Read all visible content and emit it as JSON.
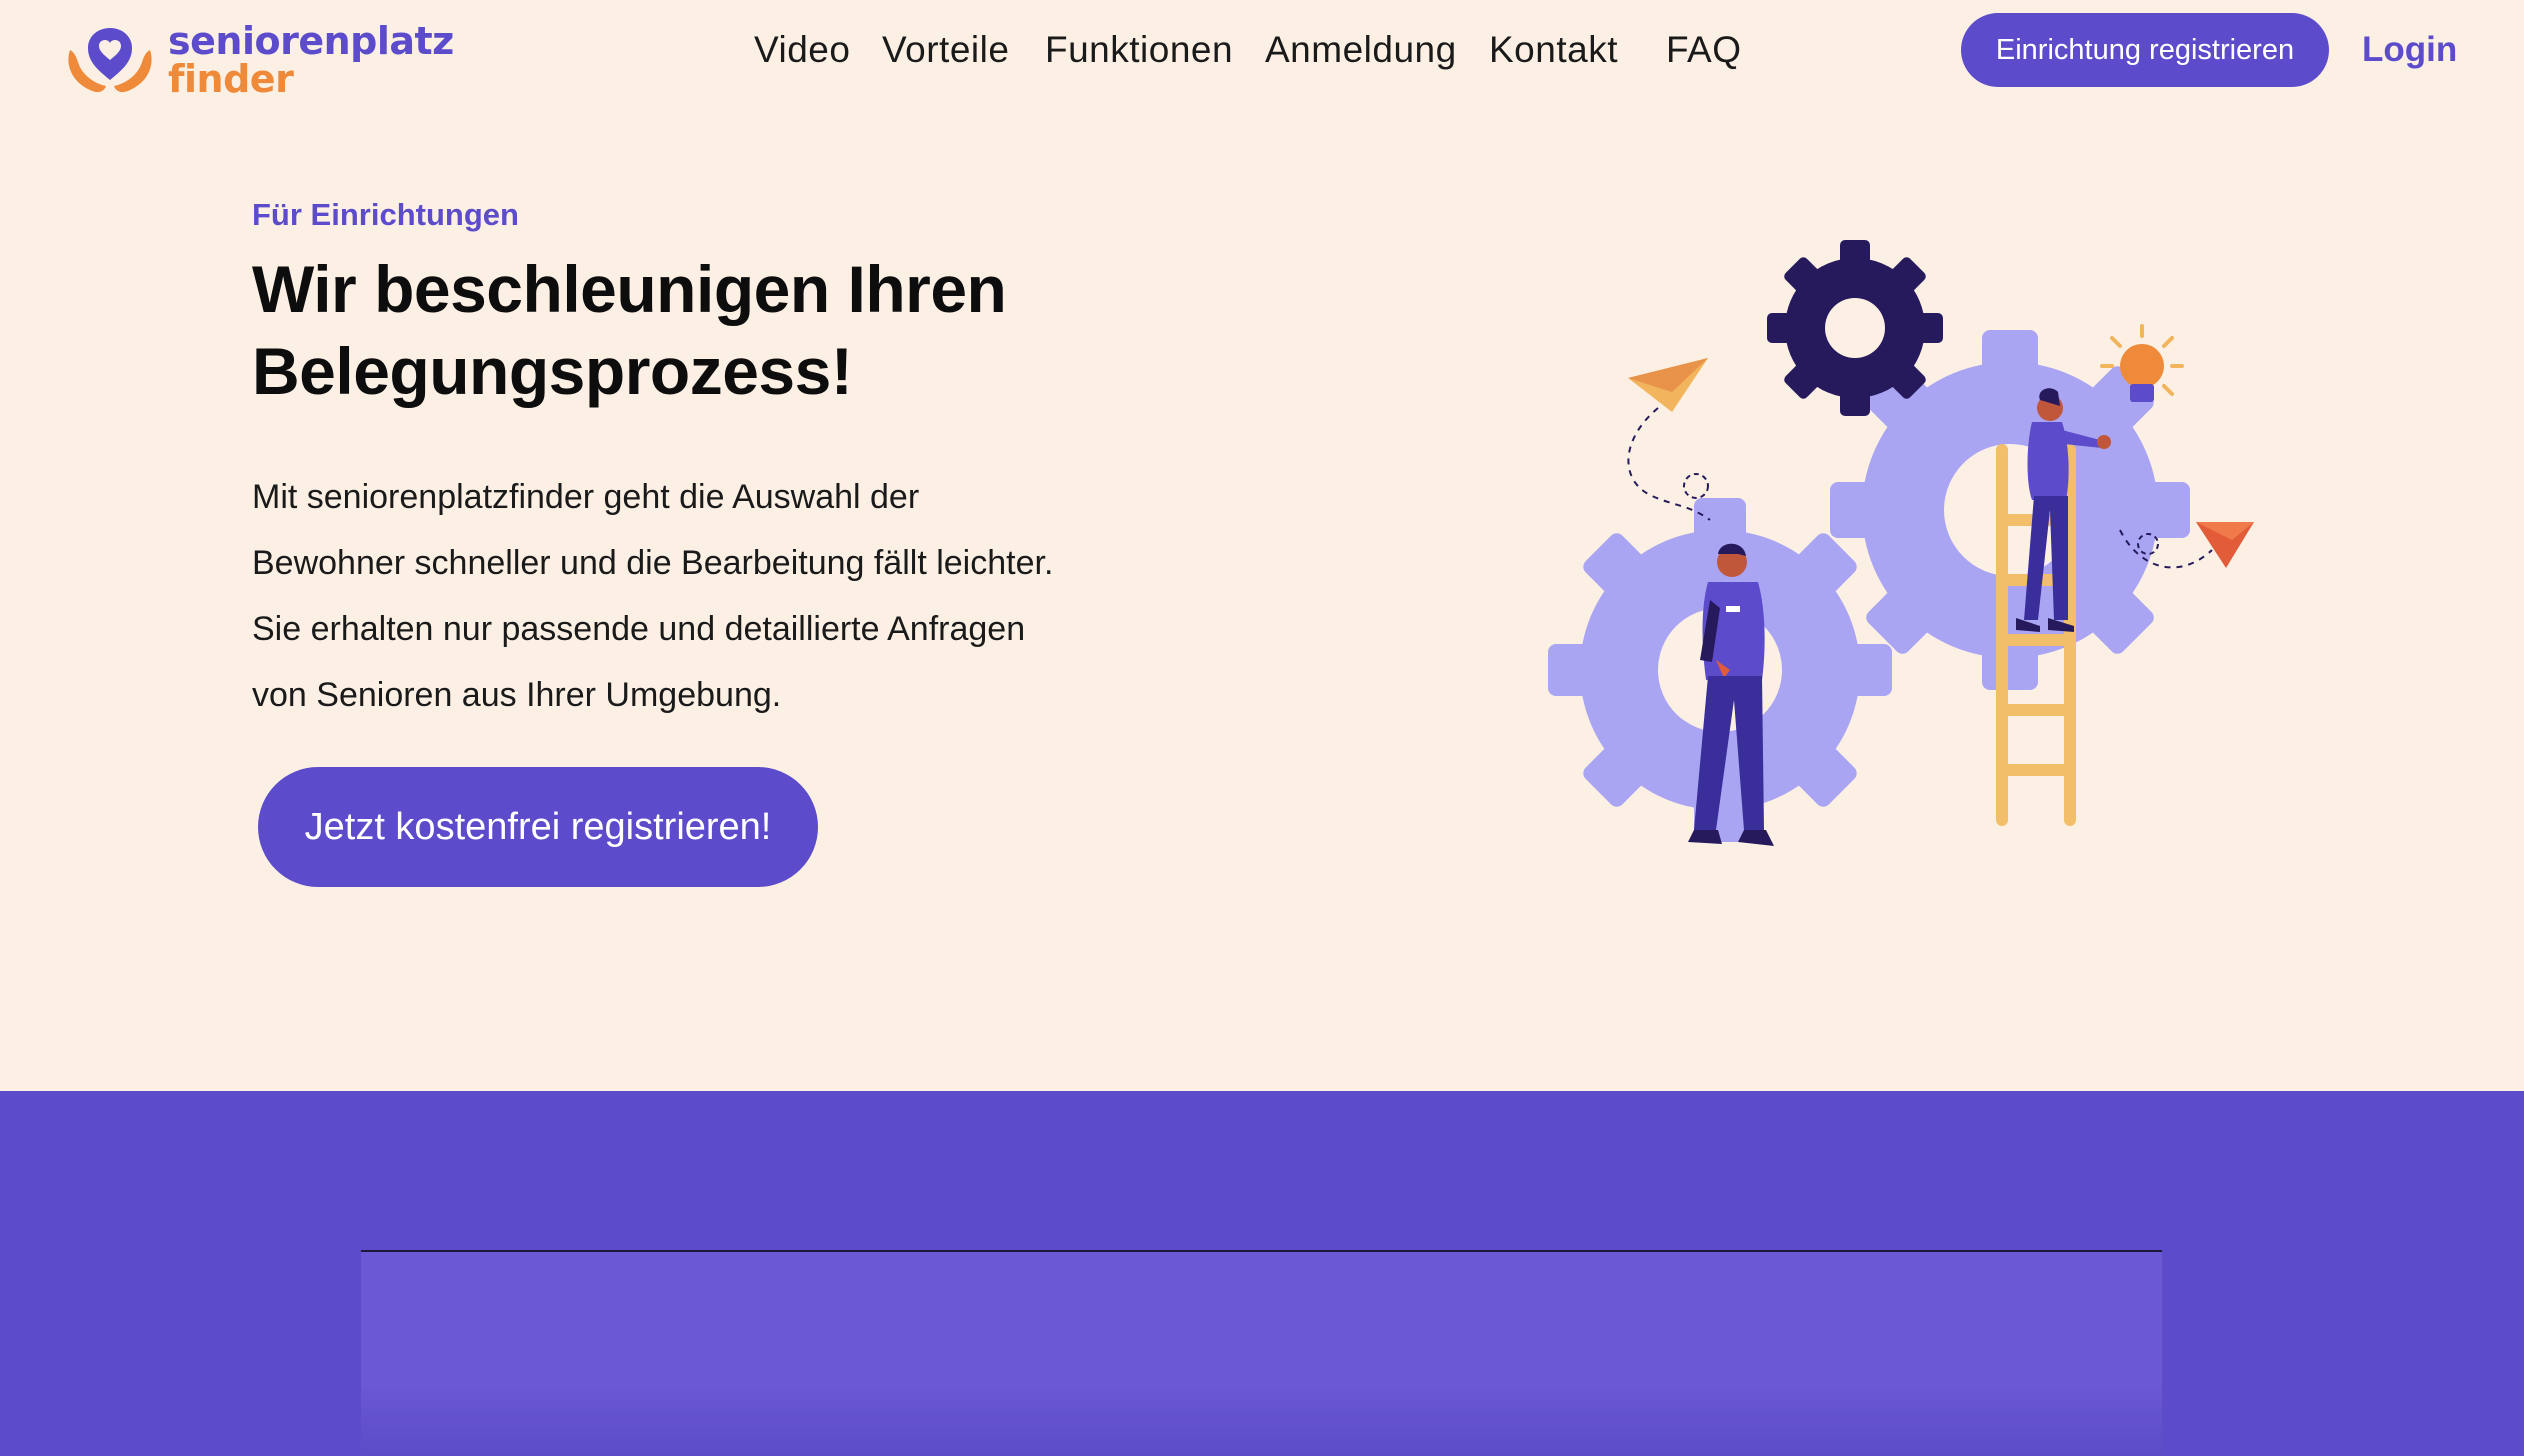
{
  "brand": {
    "name_line1": "seniorenplatz",
    "name_line2": "finder",
    "colors": {
      "primary": "#5c4ccb",
      "accent": "#ee8a3a",
      "background": "#fcf0e5"
    },
    "logo_icon": "heart-hands-icon"
  },
  "nav": {
    "items": [
      "Video",
      "Vorteile",
      "Funktionen",
      "Anmeldung",
      "Kontakt",
      "FAQ"
    ],
    "register_label": "Einrichtung registrieren",
    "login_label": "Login"
  },
  "hero": {
    "eyebrow": "Für Einrichtungen",
    "headline_line1": "Wir beschleunigen Ihren",
    "headline_line2": "Belegungsprozess!",
    "body_lines": [
      "Mit seniorenplatzfinder geht die Auswahl der",
      "Bewohner schneller und die Bearbeitung fällt leichter.",
      "Sie erhalten nur passende und detaillierte Anfragen",
      "von Senioren aus Ihrer Umgebung."
    ],
    "cta_label": "Jetzt kostenfrei registrieren!"
  },
  "illustration": {
    "icons": [
      "gear-icon",
      "paper-plane-icon",
      "lightbulb-icon",
      "ladder-icon",
      "person-icon"
    ]
  }
}
